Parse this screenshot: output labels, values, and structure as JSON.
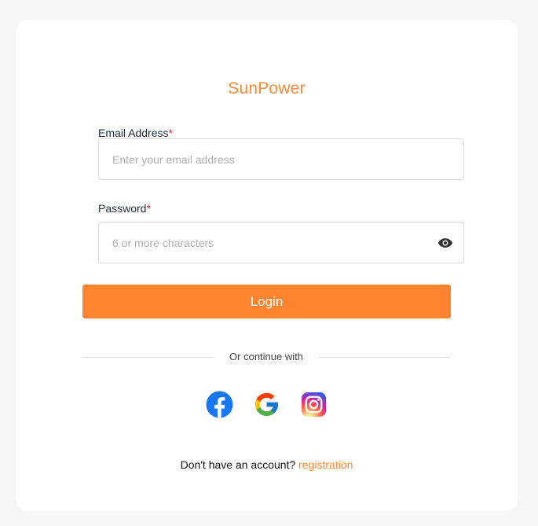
{
  "brand": "SunPower",
  "email": {
    "label": "Email Address",
    "required_mark": "*",
    "placeholder": "Enter your email address",
    "value": ""
  },
  "password": {
    "label": "Password",
    "required_mark": "*",
    "placeholder": "6 or more characters",
    "value": "",
    "toggle_icon": "eye-icon"
  },
  "login_button": "Login",
  "divider_text": "Or continue with",
  "social": [
    {
      "name": "facebook",
      "icon": "facebook-icon",
      "color": "#1877f2"
    },
    {
      "name": "google",
      "icon": "google-icon",
      "color": "#4285f4"
    },
    {
      "name": "instagram",
      "icon": "instagram-icon",
      "color": "#e1306c"
    }
  ],
  "footer": {
    "prompt": "Don't have an account?",
    "link": "registration"
  },
  "colors": {
    "accent": "#fe8430",
    "brand_text": "#fb8a33",
    "required": "#e0262b",
    "background": "#f7f7f7",
    "card": "#ffffff"
  }
}
